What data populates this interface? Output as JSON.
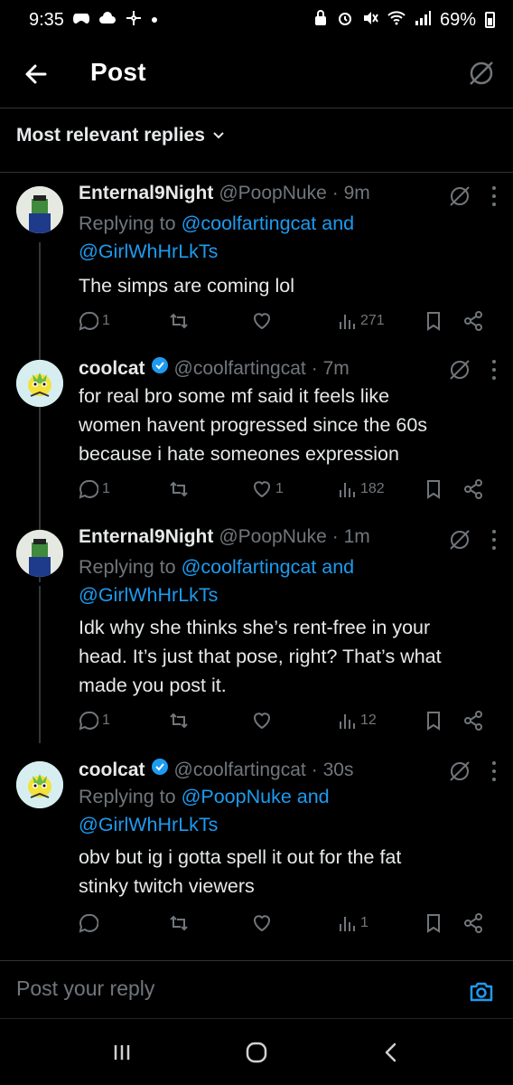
{
  "status_bar": {
    "time": "9:35",
    "battery": "69%"
  },
  "header": {
    "title": "Post"
  },
  "sort": {
    "label": "Most relevant replies"
  },
  "replies": [
    {
      "display_name": "Enternal9Night",
      "handle": "@PoopNuke",
      "time": "· 9m",
      "replying_prefix": "Replying to",
      "replying_line1": "@coolfartingcat and",
      "replying_line2": "@GirlWhHrLkTs",
      "text_lines": [
        "The simps are coming lol"
      ],
      "replies_count": "1",
      "reposts_count": "",
      "likes_count": "",
      "views_count": "271"
    },
    {
      "display_name": "coolcat",
      "handle": "@coolfartingcat",
      "time": "· 7m",
      "text_lines": [
        "for real bro some mf said it feels like",
        "women havent progressed since the 60s",
        "because i hate someones expression"
      ],
      "replies_count": "1",
      "reposts_count": "",
      "likes_count": "1",
      "views_count": "182"
    },
    {
      "display_name": "Enternal9Night",
      "handle": "@PoopNuke",
      "time": "· 1m",
      "replying_prefix": "Replying to",
      "replying_line1": "@coolfartingcat and",
      "replying_line2": "@GirlWhHrLkTs",
      "text_lines": [
        "Idk why she thinks she’s rent-free in your",
        "head. It’s just that pose, right? That’s what",
        "made you post it."
      ],
      "replies_count": "1",
      "reposts_count": "",
      "likes_count": "",
      "views_count": "12"
    },
    {
      "display_name": "coolcat",
      "handle": "@coolfartingcat",
      "time": "· 30s",
      "replying_prefix": "Replying to",
      "replying_line1": "@PoopNuke and",
      "replying_line2": "@GirlWhHrLkTs",
      "text_lines": [
        "obv but ig i gotta spell it out for the fat",
        "stinky twitch viewers"
      ],
      "replies_count": "",
      "reposts_count": "",
      "likes_count": "",
      "views_count": "1"
    }
  ],
  "composer": {
    "placeholder": "Post your reply"
  },
  "colors": {
    "background": "#000000",
    "text": "#e7e9ea",
    "muted": "#71767b",
    "accent": "#1d9bf0"
  }
}
